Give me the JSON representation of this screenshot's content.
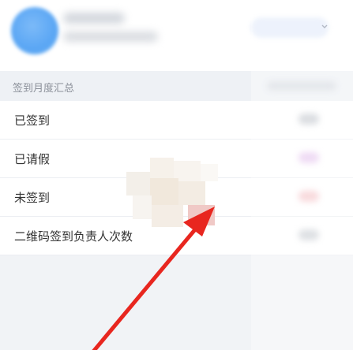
{
  "section": {
    "title": "签到月度汇总"
  },
  "summary_rows": [
    {
      "label": "已签到",
      "value_color": "#c8ccd2"
    },
    {
      "label": "已请假",
      "value_color": "#e7c9ef"
    },
    {
      "label": "未签到",
      "value_color": "#f5c7cb"
    },
    {
      "label": "二维码签到负责人次数",
      "value_color": "#cdd1d6"
    }
  ],
  "colors": {
    "page_background": "#f1f3f6",
    "avatar": "#5aa6f4",
    "annotation_arrow": "#e8261f"
  },
  "icons": {
    "month_picker": "chevron-down-icon",
    "annotation": "arrow-icon"
  }
}
